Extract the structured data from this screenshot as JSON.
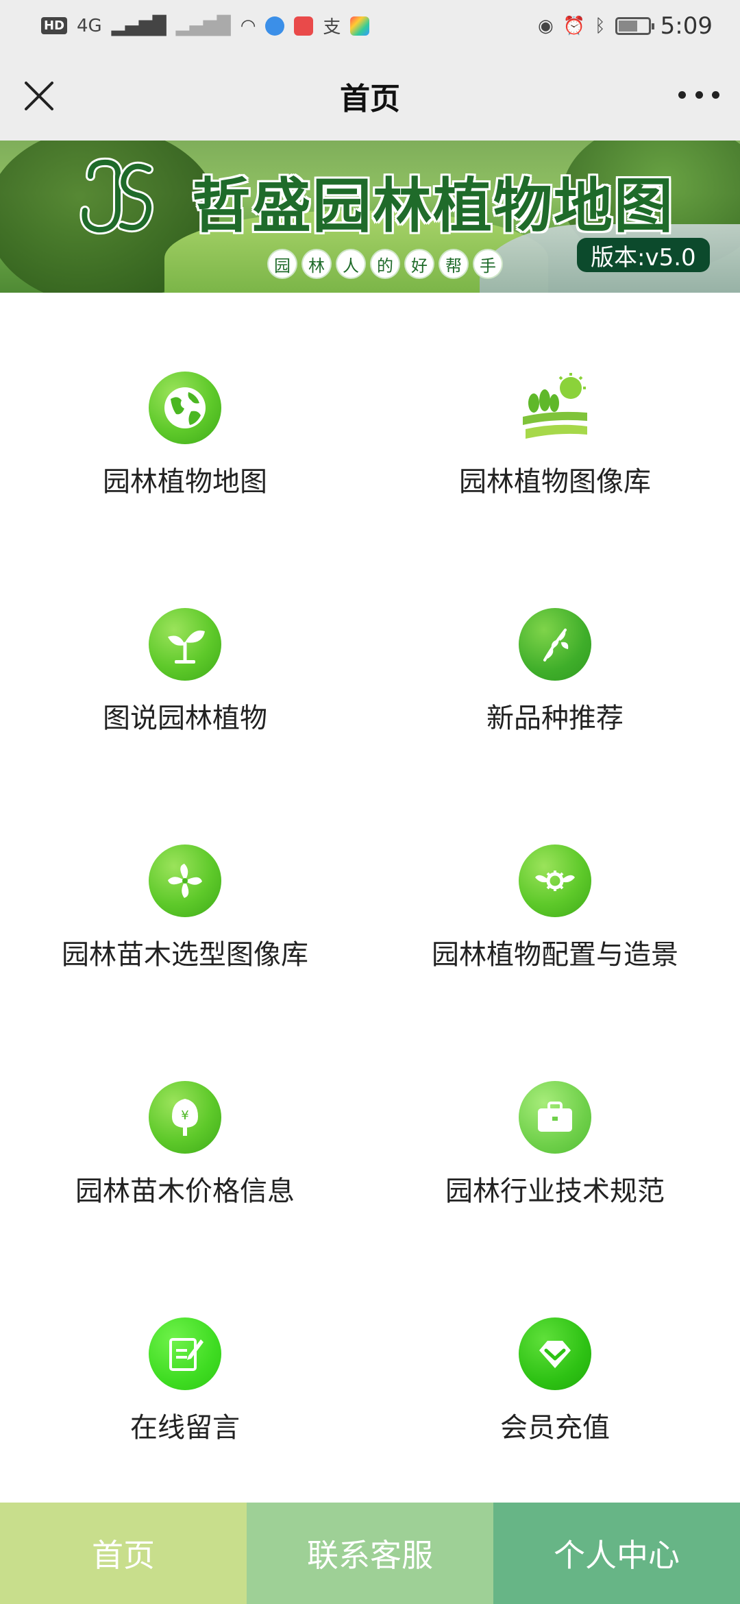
{
  "status_bar": {
    "network": "4G",
    "time": "5:09"
  },
  "nav": {
    "title": "首页"
  },
  "banner": {
    "title": "哲盛园林植物地图",
    "slogan_chars": [
      "园",
      "林",
      "人",
      "的",
      "好",
      "帮",
      "手"
    ],
    "version": "版本:v5.0"
  },
  "menu": [
    {
      "label": "园林植物地图",
      "icon": "globe-icon"
    },
    {
      "label": "园林植物图像库",
      "icon": "landscape-icon"
    },
    {
      "label": "图说园林植物",
      "icon": "sprout-icon"
    },
    {
      "label": "新品种推荐",
      "icon": "leaf-icon"
    },
    {
      "label": "园林苗木选型图像库",
      "icon": "pinwheel-icon"
    },
    {
      "label": "园林植物配置与造景",
      "icon": "gear-wings-icon"
    },
    {
      "label": "园林苗木价格信息",
      "icon": "tree-price-icon"
    },
    {
      "label": "园林行业技术规范",
      "icon": "briefcase-icon"
    },
    {
      "label": "在线留言",
      "icon": "edit-note-icon"
    },
    {
      "label": "会员充值",
      "icon": "diamond-icon"
    }
  ],
  "tabs": {
    "home": "首页",
    "service": "联系客服",
    "profile": "个人中心"
  },
  "colors": {
    "accent_green": "#5ec92a",
    "banner_title": "#1f6b2a",
    "tab_home": "#c8de8c",
    "tab_service": "#9ed096",
    "tab_profile": "#67b586"
  }
}
